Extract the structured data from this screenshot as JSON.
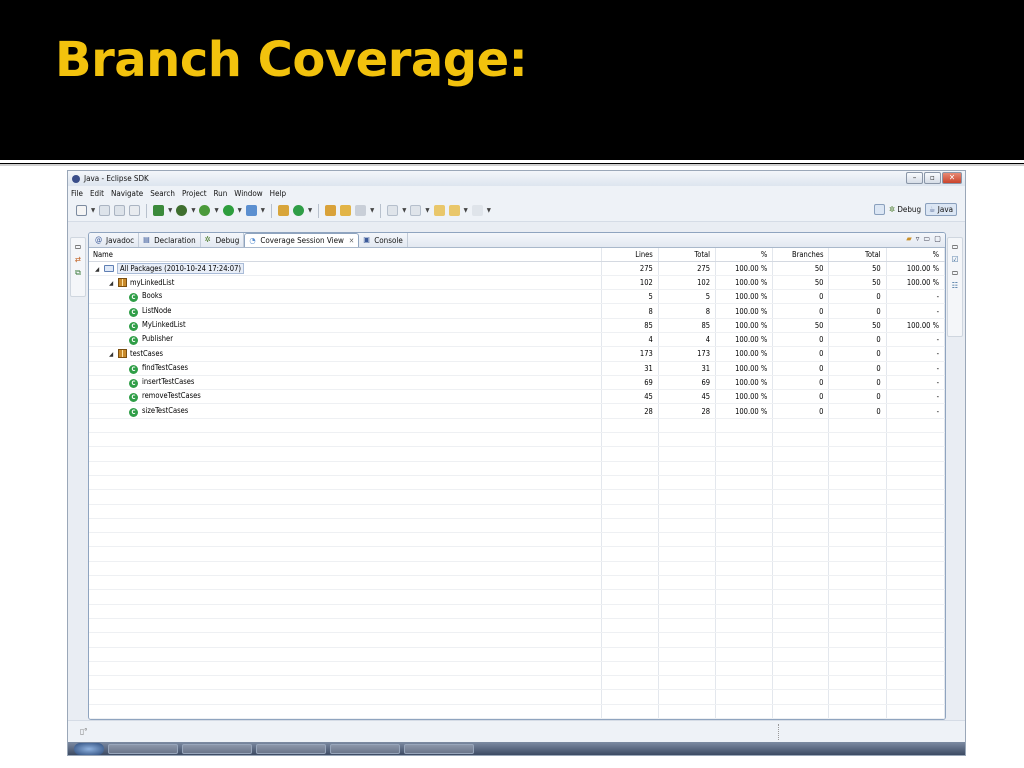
{
  "slide": {
    "title": "Branch Coverage:"
  },
  "window": {
    "title": "Java - Eclipse SDK",
    "controls": [
      "–",
      "▫",
      "✕"
    ]
  },
  "menu": [
    "File",
    "Edit",
    "Navigate",
    "Search",
    "Project",
    "Run",
    "Window",
    "Help"
  ],
  "perspectives": {
    "debug": "Debug",
    "java": "Java"
  },
  "tabs": [
    {
      "label": "Javadoc",
      "icon": "javadoc-icon",
      "glyph": "@"
    },
    {
      "label": "Declaration",
      "icon": "declaration-icon",
      "glyph": "▤"
    },
    {
      "label": "Debug",
      "icon": "debug-icon",
      "glyph": "✲"
    },
    {
      "label": "Coverage Session View",
      "icon": "coverage-icon",
      "glyph": "◔",
      "active": true
    },
    {
      "label": "Console",
      "icon": "console-icon",
      "glyph": "▣"
    }
  ],
  "columns": [
    "Name",
    "Lines",
    "Total",
    "%",
    "Branches",
    "Total",
    "%"
  ],
  "rows": [
    {
      "level": 0,
      "kind": "folder",
      "twisty": "◢",
      "selected": true,
      "name": "All Packages (2010-10-24 17:24:07)",
      "lines": "275",
      "lines_total": "275",
      "lines_pct": "100.00 %",
      "branches": "50",
      "branches_total": "50",
      "branches_pct": "100.00 %"
    },
    {
      "level": 1,
      "kind": "package",
      "twisty": "◢",
      "name": "myLinkedList",
      "lines": "102",
      "lines_total": "102",
      "lines_pct": "100.00 %",
      "branches": "50",
      "branches_total": "50",
      "branches_pct": "100.00 %"
    },
    {
      "level": 2,
      "kind": "class",
      "name": "Books",
      "lines": "5",
      "lines_total": "5",
      "lines_pct": "100.00 %",
      "branches": "0",
      "branches_total": "0",
      "branches_pct": "-"
    },
    {
      "level": 2,
      "kind": "class",
      "name": "ListNode",
      "lines": "8",
      "lines_total": "8",
      "lines_pct": "100.00 %",
      "branches": "0",
      "branches_total": "0",
      "branches_pct": "-"
    },
    {
      "level": 2,
      "kind": "class",
      "name": "MyLinkedList",
      "lines": "85",
      "lines_total": "85",
      "lines_pct": "100.00 %",
      "branches": "50",
      "branches_total": "50",
      "branches_pct": "100.00 %"
    },
    {
      "level": 2,
      "kind": "class",
      "name": "Publisher",
      "lines": "4",
      "lines_total": "4",
      "lines_pct": "100.00 %",
      "branches": "0",
      "branches_total": "0",
      "branches_pct": "-"
    },
    {
      "level": 1,
      "kind": "package",
      "twisty": "◢",
      "name": "testCases",
      "lines": "173",
      "lines_total": "173",
      "lines_pct": "100.00 %",
      "branches": "0",
      "branches_total": "0",
      "branches_pct": "-"
    },
    {
      "level": 2,
      "kind": "class",
      "name": "findTestCases",
      "lines": "31",
      "lines_total": "31",
      "lines_pct": "100.00 %",
      "branches": "0",
      "branches_total": "0",
      "branches_pct": "-"
    },
    {
      "level": 2,
      "kind": "class",
      "name": "insertTestCases",
      "lines": "69",
      "lines_total": "69",
      "lines_pct": "100.00 %",
      "branches": "0",
      "branches_total": "0",
      "branches_pct": "-"
    },
    {
      "level": 2,
      "kind": "class",
      "name": "removeTestCases",
      "lines": "45",
      "lines_total": "45",
      "lines_pct": "100.00 %",
      "branches": "0",
      "branches_total": "0",
      "branches_pct": "-"
    },
    {
      "level": 2,
      "kind": "class",
      "name": "sizeTestCases",
      "lines": "28",
      "lines_total": "28",
      "lines_pct": "100.00 %",
      "branches": "0",
      "branches_total": "0",
      "branches_pct": "-"
    }
  ],
  "empty_rows": 21,
  "colors": {
    "title": "#f2c20d",
    "class_icon": "#2f9e47",
    "package_icon": "#c98a2b",
    "close_button": "#c9432b"
  }
}
